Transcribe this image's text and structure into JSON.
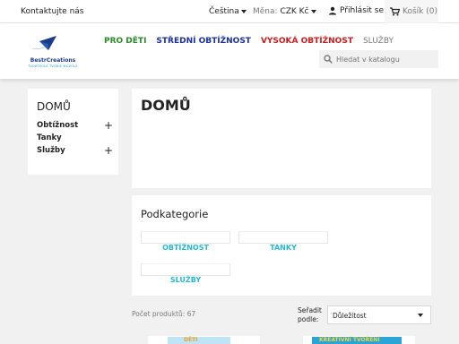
{
  "topbar": {
    "contact": "Kontaktujte nás",
    "language": "Čeština",
    "currency_label": "Měna:",
    "currency_value": "CZK Kč",
    "login": "Přihlásit se",
    "cart": "Košík (0)"
  },
  "logo": {
    "brand": "BestrCreations",
    "tagline": "TVORTVOLE TVORIE MOZOLE"
  },
  "nav": {
    "items": [
      "PRO DĚTI",
      "STŘEDNÍ OBTÍŽNOST",
      "VYSOKÁ OBTÍŽNOST",
      "SLUŽBY"
    ]
  },
  "search": {
    "placeholder": "Hledat v katalogu"
  },
  "sidebar": {
    "title": "DOMŮ",
    "items": [
      {
        "label": "Obtížnost",
        "expandable": "+"
      },
      {
        "label": "Tanky",
        "expandable": ""
      },
      {
        "label": "Služby",
        "expandable": "+"
      }
    ]
  },
  "main": {
    "title": "DOMŮ"
  },
  "subcategories": {
    "title": "Podkategorie",
    "items": [
      "OBTÍŽNOST",
      "TANKY",
      "SLUŽBY"
    ]
  },
  "listing": {
    "count": "Počet produktů: 67",
    "sort_label": "Seřadit podle:",
    "sort_value": "Důležitost"
  },
  "products": {
    "p1_text": "DĚTI",
    "p2_text": "KREATIVNÍ TVOŘENÍ"
  },
  "colors": {
    "accent": "#24b9d7",
    "nav_green": "#2a8a2a",
    "nav_blue": "#1a2fa8",
    "nav_red": "#d21a1a"
  }
}
